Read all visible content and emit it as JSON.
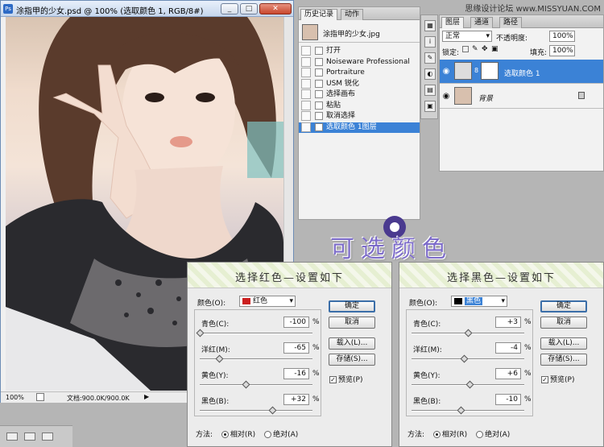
{
  "watermark": "思缘设计论坛 www.MISSYUAN.COM",
  "document": {
    "title": "涂指甲的少女.psd @ 100% (选取颜色 1, RGB/8#)",
    "title_icon": "Ps",
    "minimize": "_",
    "maximize": "□",
    "close": "✕",
    "zoom": "100%",
    "doc_size": "文档:900.0K/900.0K"
  },
  "history": {
    "tabs": [
      "历史记录",
      "动作"
    ],
    "snapshot": "涂指甲的少女.jpg",
    "items": [
      "打开",
      "Noiseware Professional",
      "Portraiture",
      "USM 锐化",
      "选择画布",
      "粘贴",
      "取消选择",
      "选取颜色 1图层"
    ],
    "selected_index": 7
  },
  "layers": {
    "tabs": [
      "图层",
      "通道",
      "路径"
    ],
    "blend_mode": "正常",
    "opacity_label": "不透明度:",
    "opacity": "100%",
    "lock_label": "锁定:",
    "fill_label": "填充:",
    "fill": "100%",
    "items": [
      {
        "name": "选取颜色 1",
        "selected": true
      },
      {
        "name": "背景",
        "selected": false
      }
    ]
  },
  "banner": {
    "text": "可选颜色"
  },
  "dialog_red": {
    "header": "选择红色—设置如下",
    "colors_label": "颜色(O):",
    "color_value": "红色",
    "swatch": "#cc1f1f",
    "fields": [
      {
        "label": "青色(C):",
        "value": "-100",
        "pos": 0.0
      },
      {
        "label": "洋红(M):",
        "value": "-65",
        "pos": 0.175
      },
      {
        "label": "黄色(Y):",
        "value": "-16",
        "pos": 0.42
      },
      {
        "label": "黑色(B):",
        "value": "+32",
        "pos": 0.66
      }
    ],
    "pct": "%",
    "ok": "确定",
    "cancel": "取消",
    "load": "载入(L)...",
    "save": "存储(S)...",
    "preview": "预览(P)",
    "method_label": "方法:",
    "relative": "相对(R)",
    "absolute": "绝对(A)"
  },
  "dialog_black": {
    "header": "选择黑色—设置如下",
    "colors_label": "颜色(O):",
    "color_value": "黑色",
    "swatch": "#000000",
    "fields": [
      {
        "label": "青色(C):",
        "value": "+3",
        "pos": 0.515
      },
      {
        "label": "洋红(M):",
        "value": "-4",
        "pos": 0.48
      },
      {
        "label": "黄色(Y):",
        "value": "+6",
        "pos": 0.53
      },
      {
        "label": "黑色(B):",
        "value": "-10",
        "pos": 0.45
      }
    ],
    "pct": "%",
    "ok": "确定",
    "cancel": "取消",
    "load": "载入(L)...",
    "save": "存储(S)...",
    "preview": "预览(P)",
    "method_label": "方法:",
    "relative": "相对(R)",
    "absolute": "绝对(A)"
  }
}
